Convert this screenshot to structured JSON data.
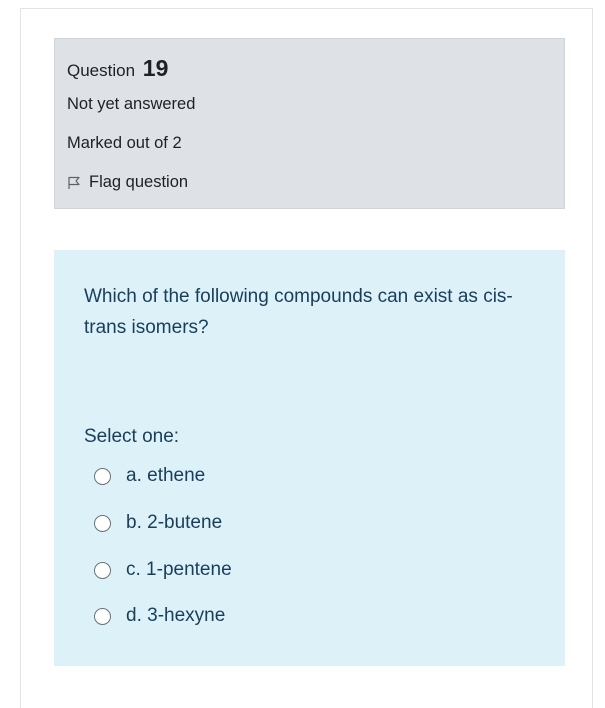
{
  "question": {
    "label": "Question",
    "number": "19",
    "state": "Not yet answered",
    "grade": "Marked out of 2",
    "flag_label": "Flag question",
    "flag_icon": "flag-icon",
    "text": "Which of the following compounds can exist as cis-trans isomers?",
    "prompt": "Select one:",
    "options": [
      {
        "label": "a. ethene"
      },
      {
        "label": "b. 2-butene"
      },
      {
        "label": "c. 1-pentene"
      },
      {
        "label": "d. 3-hexyne"
      }
    ]
  },
  "colors": {
    "info_background": "#dee2e6",
    "content_background": "#dcf1f8",
    "content_text": "#1a3e5a"
  }
}
